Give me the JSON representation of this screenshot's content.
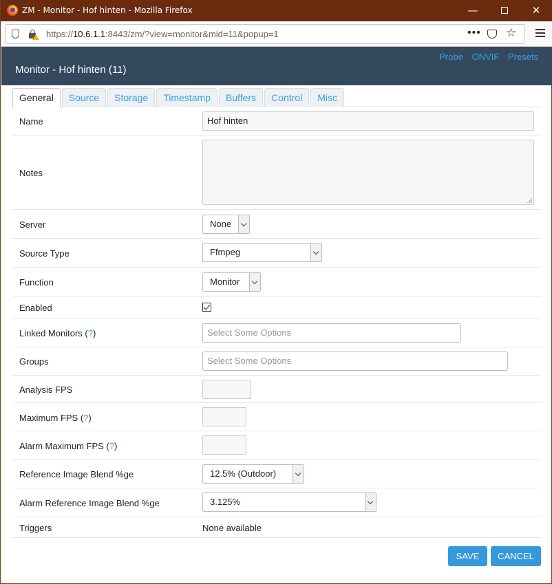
{
  "window": {
    "title": "ZM - Monitor - Hof hinten - Mozilla Firefox",
    "min_label": "—",
    "close_label": "✕"
  },
  "browser": {
    "url_prefix": "https://",
    "url_host": "10.6.1.1",
    "url_rest": ":8443/zm/?view=monitor&mid=11&popup=1",
    "dots": "•••",
    "star": "☆"
  },
  "header": {
    "title": "Monitor - Hof hinten (11)",
    "links": [
      "Probe",
      "ONVIF",
      "Presets"
    ]
  },
  "tabs": [
    "General",
    "Source",
    "Storage",
    "Timestamp",
    "Buffers",
    "Control",
    "Misc"
  ],
  "active_tab": "General",
  "form": {
    "name_label": "Name",
    "name_value": "Hof hinten",
    "notes_label": "Notes",
    "notes_value": "",
    "server_label": "Server",
    "server_value": "None",
    "source_type_label": "Source Type",
    "source_type_value": "Ffmpeg",
    "function_label": "Function",
    "function_value": "Monitor",
    "enabled_label": "Enabled",
    "enabled_checked": true,
    "linked_monitors_label": "Linked Monitors",
    "linked_monitors_help": "?",
    "linked_monitors_placeholder": "Select Some Options",
    "groups_label": "Groups",
    "groups_placeholder": "Select Some Options",
    "analysis_fps_label": "Analysis FPS",
    "analysis_fps_value": "",
    "max_fps_label": "Maximum FPS",
    "max_fps_help": "?",
    "max_fps_value": "",
    "alarm_max_fps_label": "Alarm Maximum FPS",
    "alarm_max_fps_help": "?",
    "alarm_max_fps_value": "",
    "ref_blend_label": "Reference Image Blend %ge",
    "ref_blend_value": "12.5% (Outdoor)",
    "alarm_ref_blend_label": "Alarm Reference Image Blend %ge",
    "alarm_ref_blend_value": "3.125%",
    "triggers_label": "Triggers",
    "triggers_value": "None available"
  },
  "buttons": {
    "save": "SAVE",
    "cancel": "CANCEL"
  },
  "colors": {
    "titlebar": "#6b2b0e",
    "header_bg": "#34495e",
    "link": "#3a9ee4",
    "button": "#3498db"
  }
}
